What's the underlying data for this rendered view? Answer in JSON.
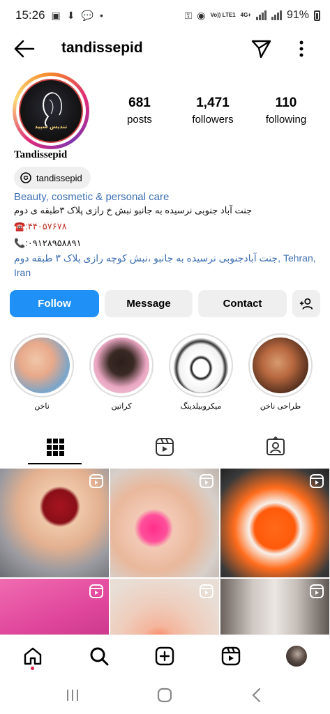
{
  "status_bar": {
    "time": "15:26",
    "battery": "91%",
    "net": "Vo)) LTE1",
    "net2": "4G+"
  },
  "header": {
    "username": "tandissepid",
    "back_icon": "arrow-left-icon",
    "send_icon": "paper-plane-icon",
    "more_icon": "more-vertical-icon"
  },
  "profile": {
    "avatar_logo_text": "تندیس سپید",
    "stats": [
      {
        "value": "681",
        "label": "posts"
      },
      {
        "value": "1,471",
        "label": "followers"
      },
      {
        "value": "110",
        "label": "following"
      }
    ],
    "display_name": "Tandissepid",
    "threads_handle": "tandissepid",
    "category": "Beauty, cosmetic & personal care",
    "bio_line1": "جنت آباد جنوبی نرسیده به جانبو نبش خ رازی پلاک ۳طبقه ی دوم",
    "phone1": "☎️:۴۴۰۵۷۶۷۸",
    "phone2": "📞:۰۹۱۲۸۹۵۸۸۹۱",
    "address_link_line1": "جنت آبادجنوبی نرسیده به جانبو ،نبش  کوچه رازی پلاک ۳ طبقه دوم, Tehran,",
    "address_link_line2": "Iran"
  },
  "buttons": {
    "follow": "Follow",
    "message": "Message",
    "contact": "Contact",
    "add_user_icon": "add-person-icon"
  },
  "highlights": [
    {
      "caption": "ناخن"
    },
    {
      "caption": "کراتین"
    },
    {
      "caption": "میکروبیلدینگ"
    },
    {
      "caption": "طراحی ناخن"
    }
  ],
  "tabs": [
    "grid-icon",
    "reels-icon",
    "tagged-icon"
  ],
  "bottom_nav": [
    "home-icon",
    "search-icon",
    "create-icon",
    "reels-icon",
    "profile-avatar"
  ],
  "colors": {
    "accent": "#1e90f6",
    "link": "#3d6fb2",
    "notification": "#e11d48"
  }
}
